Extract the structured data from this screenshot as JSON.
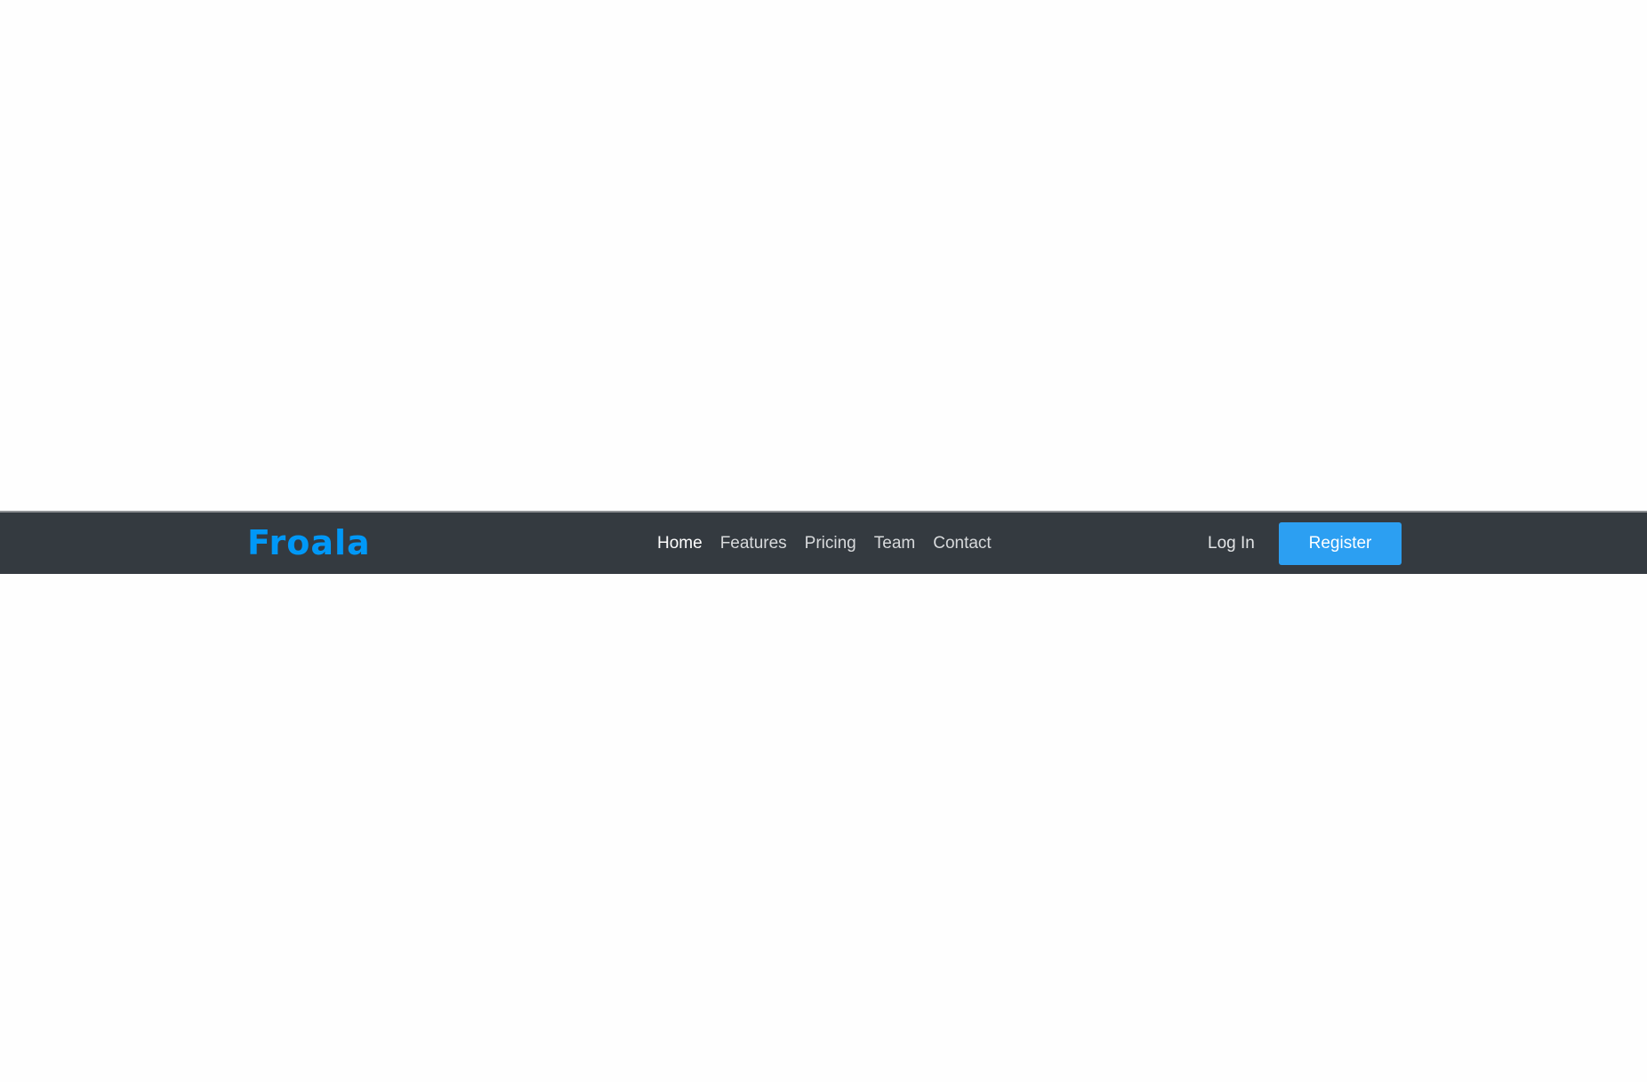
{
  "brand": {
    "logo_text": "Froala",
    "logo_color": "#0098f7"
  },
  "nav": {
    "items": [
      {
        "label": "Home",
        "active": true
      },
      {
        "label": "Features",
        "active": false
      },
      {
        "label": "Pricing",
        "active": false
      },
      {
        "label": "Team",
        "active": false
      },
      {
        "label": "Contact",
        "active": false
      }
    ]
  },
  "auth": {
    "login_label": "Log In",
    "register_label": "Register",
    "register_color": "#2c9ff2"
  },
  "colors": {
    "navbar_background": "#343a40",
    "page_background": "#fefefe"
  }
}
